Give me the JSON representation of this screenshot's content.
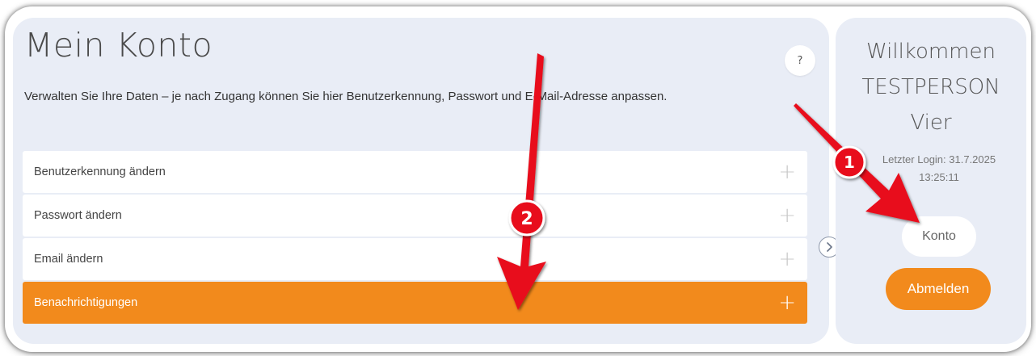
{
  "main": {
    "title": "Mein Konto",
    "help_label": "?",
    "description": "Verwalten Sie Ihre Daten – je nach Zugang können Sie hier Benutzerkennung, Passwort und E-Mail-Adresse anpassen.",
    "accordion": [
      {
        "label": "Benutzerkennung ändern",
        "expand": "+"
      },
      {
        "label": "Passwort ändern",
        "expand": "+"
      },
      {
        "label": "Email ändern",
        "expand": "+"
      },
      {
        "label": "Benachrichtigungen",
        "expand": "+",
        "active": true
      }
    ],
    "toggle_icon": "chevron-right-icon"
  },
  "sidebar": {
    "welcome_line1": "Willkommen",
    "welcome_line2": "TESTPERSON",
    "welcome_line3": "Vier",
    "last_login_label": "Letzter Login: 31.7.2025",
    "last_login_time": "13:25:11",
    "account_button": "Konto",
    "logout_button": "Abmelden"
  },
  "annotations": {
    "marker_1": "1",
    "marker_2": "2"
  },
  "colors": {
    "accent": "#f28a1c",
    "panel_bg": "#e9edf6",
    "annotation_red": "#e8101c"
  }
}
